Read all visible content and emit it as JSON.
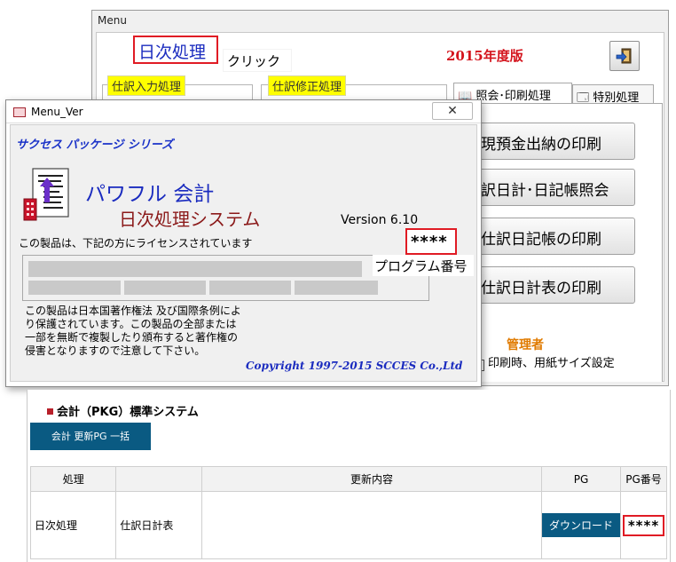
{
  "menu_window": {
    "title": "Menu",
    "daily_processing": "日次処理",
    "click_hint": "クリック",
    "fiscal_edition": "2015年度版",
    "groups": {
      "entry": "仕訳入力処理",
      "revise": "仕訳修正処理"
    },
    "tabs": [
      "照会･印刷処理",
      "特別処理"
    ],
    "buttons": [
      "現預金出納の印刷",
      "訳日計･日記帳照会",
      "仕訳日記帳の印刷",
      "仕訳日計表の印刷"
    ],
    "admin_label": "管理者",
    "paper_size_option": "印刷時、用紙サイズ設定",
    "paper_size_checked": true
  },
  "about_dialog": {
    "title": "Menu_Ver",
    "close_glyph": "✕",
    "series": "サクセス パッケージ シリーズ",
    "product_name": "パワフル 会計",
    "system_name": "日次処理システム",
    "version": "Version 6.10",
    "license_text": "この製品は、下記の方にライセンスされています",
    "program_number_value": "****",
    "program_number_label": "プログラム番号",
    "notice": "この製品は日本国著作権法 及び国際条例により保護されています。この製品の全部または一部を無断で複製したり頒布すると著作権の侵害となりますので注意して下さい。",
    "copyright": "Copyright 1997-2015 SCCES Co.,Ltd"
  },
  "pkg_panel": {
    "title": "会計（PKG）標準システム",
    "bulk_update_button": "会計 更新PG 一括",
    "table": {
      "headers": [
        "処理",
        "",
        "更新内容",
        "PG",
        "PG番号"
      ],
      "rows": [
        {
          "process": "日次処理",
          "item": "仕訳日計表",
          "content": "",
          "pg_action": "ダウンロード",
          "pg_number": "****"
        }
      ]
    }
  },
  "colors": {
    "highlight_red": "#e01b24",
    "title_blue": "#1a2bbf",
    "button_blue": "#0a5a82",
    "group_yellow": "#ffff00",
    "admin_orange": "#e07b00"
  }
}
